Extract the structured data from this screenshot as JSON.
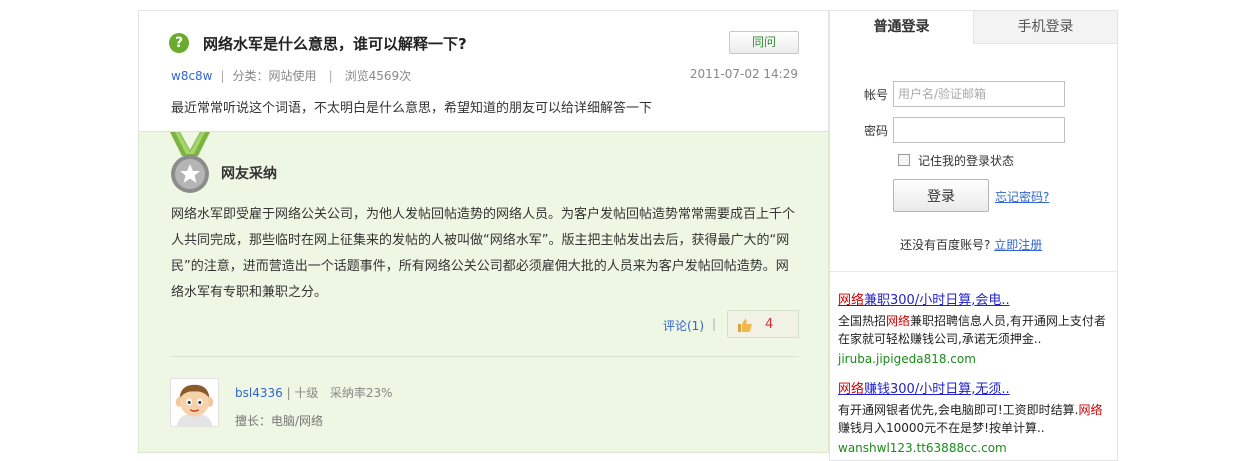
{
  "question": {
    "title": "网络水军是什么意思，谁可以解释一下?",
    "same_question_button": "同问",
    "asker": "w8c8w",
    "category": "分类：网站使用",
    "views": "浏览4569次",
    "time": "2011-07-02 14:29",
    "body": "最近常常听说这个词语，不太明白是什么意思，希望知道的朋友可以给详细解答一下"
  },
  "answer": {
    "heading": "网友采纳",
    "text": "网络水军即受雇于网络公关公司，为他人发帖回帖造势的网络人员。为客户发帖回帖造势常常需要成百上千个人共同完成，那些临时在网上征集来的发帖的人被叫做“网络水军”。版主把主帖发出去后，获得最广大的“网民”的注意，进而营造出一个话题事件，所有网络公关公司都必须雇佣大批的人员来为客户发帖回帖造势。网络水军有专职和兼职之分。",
    "comment_link": "评论(1)",
    "comment_sep": "|",
    "like_count": "4",
    "user": {
      "name": "bsl4336",
      "level": "| 十级",
      "rate": "采纳率23%",
      "specialty": "擅长：电脑/网络"
    }
  },
  "login": {
    "tab_normal": "普通登录",
    "tab_mobile": "手机登录",
    "account_label": "帐号",
    "account_placeholder": "用户名/验证邮箱",
    "password_label": "密码",
    "remember_label": "记住我的登录状态",
    "login_button": "登录",
    "forgot_link": "忘记密码?",
    "no_account_text": "还没有百度账号?",
    "register_link": "立即注册"
  },
  "ads": [
    {
      "title_hl": "网络",
      "title_rest": "兼职300/小时日算,会电..",
      "desc_pre": "全国热招",
      "desc_hl": "网络",
      "desc_post": "兼职招聘信息人员,有开通网上支付者在家就可轻松赚钱公司,承诺无须押金..",
      "url": "jiruba.jipigeda818.com"
    },
    {
      "title_hl": "网络",
      "title_rest": "赚钱300/小时日算,无须..",
      "desc_pre": "有开通网银者优先,会电脑即可!工资即时结算.",
      "desc_hl": "网络",
      "desc_post": "赚钱月入10000元不在是梦!按单计算..",
      "url": "wanshwl123.tt63888cc.com"
    }
  ],
  "colors": {
    "answer_bg": "#edf7e3",
    "link_blue": "#3366cc",
    "accent_green": "#6aab2e",
    "ad_red": "#cc0000"
  }
}
